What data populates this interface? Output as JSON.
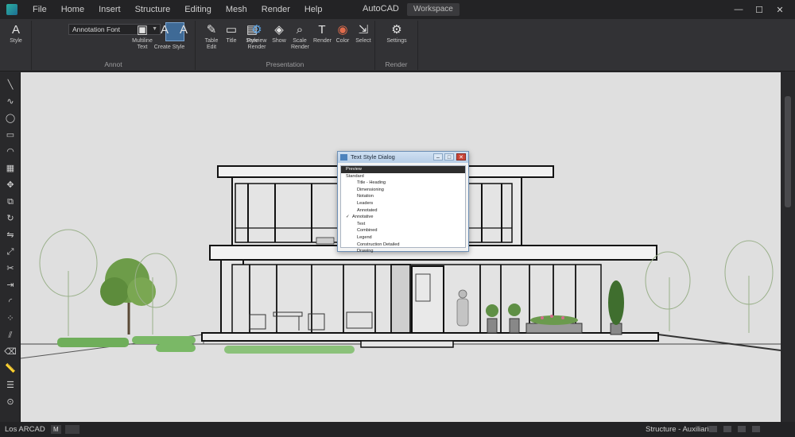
{
  "app": {
    "title": "AutoCAD",
    "workspace": "Workspace",
    "menu": [
      "File",
      "Home",
      "Insert",
      "Structure",
      "Editing",
      "Mesh",
      "Render",
      "Help"
    ],
    "window_controls": [
      "—",
      "☐",
      "✕"
    ]
  },
  "ribbon": {
    "font_value": "Annotation Font",
    "groups": [
      {
        "label": "Annot"
      },
      {
        "label": "Presentation"
      },
      {
        "label": "Render"
      }
    ],
    "tools": [
      {
        "name": "text-style",
        "label": "Style",
        "icon": "A"
      },
      {
        "name": "multiline-text",
        "label": "Multiline Text",
        "icon": "▣"
      },
      {
        "name": "text-edit",
        "label": "Create Style",
        "icon": "A"
      },
      {
        "name": "text-large",
        "label": "",
        "icon": "A"
      },
      {
        "name": "pencil",
        "label": "Table Edit",
        "icon": "✎"
      },
      {
        "name": "frame",
        "label": "Title",
        "icon": "▭"
      },
      {
        "name": "page",
        "label": "Style",
        "icon": "▤"
      },
      {
        "name": "gear",
        "label": "Preview Render",
        "icon": "⚙"
      },
      {
        "name": "paint",
        "label": "Show",
        "icon": "◈"
      },
      {
        "name": "magnifier",
        "label": "Scale Render",
        "icon": "⌕"
      },
      {
        "name": "text-t",
        "label": "Render",
        "icon": "T"
      },
      {
        "name": "color-wheel",
        "label": "Color",
        "icon": "◉"
      },
      {
        "name": "select",
        "label": "Select",
        "icon": "⇲"
      },
      {
        "name": "settings",
        "label": "Settings",
        "icon": "⚙"
      }
    ]
  },
  "left_toolbar": {
    "icons": [
      "line",
      "polyline",
      "circle",
      "rectangle",
      "arc",
      "hatch",
      "move",
      "copy",
      "rotate",
      "mirror",
      "scale",
      "trim",
      "extend",
      "fillet",
      "array",
      "offset",
      "erase",
      "measure",
      "properties",
      "help"
    ]
  },
  "dialog": {
    "title": "Text Style Dialog",
    "items": [
      {
        "text": "Preview",
        "selected": true,
        "sub": false,
        "checked": false
      },
      {
        "text": "Standard",
        "selected": false,
        "sub": false,
        "checked": false
      },
      {
        "text": "Title - Heading",
        "selected": false,
        "sub": true,
        "checked": false
      },
      {
        "text": "Dimensioning",
        "selected": false,
        "sub": true,
        "checked": false
      },
      {
        "text": "Notation",
        "selected": false,
        "sub": true,
        "checked": false
      },
      {
        "text": "Leaders",
        "selected": false,
        "sub": true,
        "checked": false
      },
      {
        "text": "Annotated",
        "selected": false,
        "sub": true,
        "checked": false
      },
      {
        "text": "Annotative",
        "selected": false,
        "sub": false,
        "checked": true
      },
      {
        "text": "Text",
        "selected": false,
        "sub": true,
        "checked": false
      },
      {
        "text": "Combined",
        "selected": false,
        "sub": true,
        "checked": false
      },
      {
        "text": "Legend",
        "selected": false,
        "sub": true,
        "checked": false
      },
      {
        "text": "Construction Detailed",
        "selected": false,
        "sub": true,
        "checked": false
      },
      {
        "text": "Drawing",
        "selected": false,
        "sub": true,
        "checked": false
      }
    ]
  },
  "status": {
    "left": "Los ARCAD",
    "mini1": "M",
    "mini2": "",
    "right": "Structure - Auxiliaries"
  },
  "colors": {
    "canvas": "#dfdfdf",
    "chrome": "#323235",
    "accent": "#3f6a96",
    "tree_green": "#4f8a3a",
    "hedge_green": "#6fae5a"
  }
}
